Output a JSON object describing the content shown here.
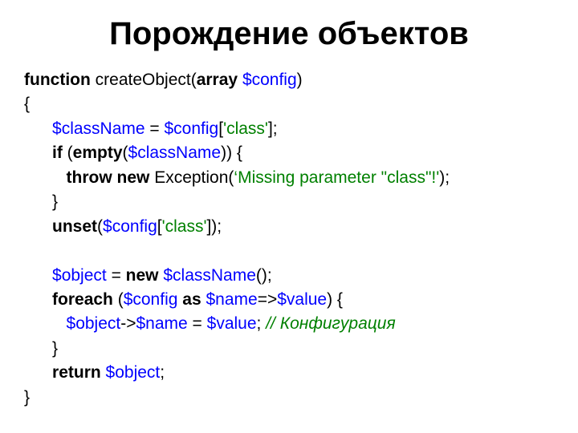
{
  "title": "Порождение объектов",
  "code": {
    "l1_kw1": "function",
    "l1_txt1": " createObject(",
    "l1_kw2": "array",
    "l1_txt2": " ",
    "l1_var1": "$config",
    "l1_txt3": ")",
    "l2": "{",
    "l3_txt1": "      ",
    "l3_var1": "$className",
    "l3_txt2": " = ",
    "l3_var2": "$config",
    "l3_txt3": "[",
    "l3_str1": "'class'",
    "l3_txt4": "];",
    "l4_txt1": "      ",
    "l4_kw1": "if",
    "l4_txt2": " (",
    "l4_kw2": "empty",
    "l4_txt3": "(",
    "l4_var1": "$className",
    "l4_txt4": ")) {",
    "l5_txt1": "         ",
    "l5_kw1": "throw new",
    "l5_txt2": " Exception(",
    "l5_str1": "‘Missing parameter \"class\"!'",
    "l5_txt3": ");",
    "l6": "      }",
    "l7_txt1": "      ",
    "l7_kw1": "unset",
    "l7_txt2": "(",
    "l7_var1": "$config",
    "l7_txt3": "[",
    "l7_str1": "'class'",
    "l7_txt4": "]);",
    "blank": "",
    "l9_txt1": "      ",
    "l9_var1": "$object",
    "l9_txt2": " = ",
    "l9_kw1": "new",
    "l9_txt3": " ",
    "l9_var2": "$className",
    "l9_txt4": "();",
    "l10_txt1": "      ",
    "l10_kw1": "foreach",
    "l10_txt2": " (",
    "l10_var1": "$config",
    "l10_txt3": " ",
    "l10_kw2": "as",
    "l10_txt4": " ",
    "l10_var2": "$name",
    "l10_txt5": "=>",
    "l10_var3": "$value",
    "l10_txt6": ") {",
    "l11_txt1": "         ",
    "l11_var1": "$object",
    "l11_txt2": "->",
    "l11_var2": "$name",
    "l11_txt3": " = ",
    "l11_var3": "$value",
    "l11_txt4": "; ",
    "l11_cmt1": "// Конфигурация",
    "l12": "      }",
    "l13_txt1": "      ",
    "l13_kw1": "return",
    "l13_txt2": " ",
    "l13_var1": "$object",
    "l13_txt3": ";",
    "l14": "}"
  }
}
